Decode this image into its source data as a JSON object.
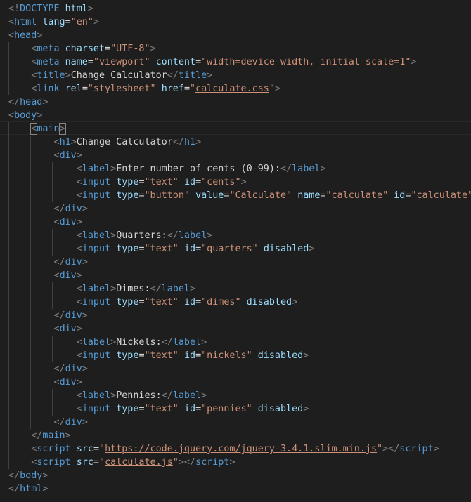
{
  "editor": {
    "language": "html",
    "theme": {
      "background": "#1e1e1e",
      "tag": "#569cd6",
      "punctuation": "#808080",
      "attribute": "#9cdcfe",
      "string": "#ce9178",
      "text": "#d4d4d4"
    },
    "lines": [
      [
        [
          "punct",
          "<!"
        ],
        [
          "tag",
          "DOCTYPE"
        ],
        [
          "txt",
          " "
        ],
        [
          "attr",
          "html"
        ],
        [
          "punct",
          ">"
        ]
      ],
      [
        [
          "punct",
          "<"
        ],
        [
          "tag",
          "html"
        ],
        [
          "txt",
          " "
        ],
        [
          "attr",
          "lang"
        ],
        [
          "txt",
          "="
        ],
        [
          "str",
          "\"en\""
        ],
        [
          "punct",
          ">"
        ]
      ],
      [
        [
          "punct",
          "<"
        ],
        [
          "tag",
          "head"
        ],
        [
          "punct",
          ">"
        ]
      ],
      [
        [
          "txt",
          "    "
        ],
        [
          "punct",
          "<"
        ],
        [
          "tag",
          "meta"
        ],
        [
          "txt",
          " "
        ],
        [
          "attr",
          "charset"
        ],
        [
          "txt",
          "="
        ],
        [
          "str",
          "\"UTF-8\""
        ],
        [
          "punct",
          ">"
        ]
      ],
      [
        [
          "txt",
          "    "
        ],
        [
          "punct",
          "<"
        ],
        [
          "tag",
          "meta"
        ],
        [
          "txt",
          " "
        ],
        [
          "attr",
          "name"
        ],
        [
          "txt",
          "="
        ],
        [
          "str",
          "\"viewport\""
        ],
        [
          "txt",
          " "
        ],
        [
          "attr",
          "content"
        ],
        [
          "txt",
          "="
        ],
        [
          "str",
          "\"width=device-width, initial-scale=1\""
        ],
        [
          "punct",
          ">"
        ]
      ],
      [
        [
          "txt",
          "    "
        ],
        [
          "punct",
          "<"
        ],
        [
          "tag",
          "title"
        ],
        [
          "punct",
          ">"
        ],
        [
          "txt",
          "Change Calculator"
        ],
        [
          "punct",
          "</"
        ],
        [
          "tag",
          "title"
        ],
        [
          "punct",
          ">"
        ]
      ],
      [
        [
          "txt",
          "    "
        ],
        [
          "punct",
          "<"
        ],
        [
          "tag",
          "link"
        ],
        [
          "txt",
          " "
        ],
        [
          "attr",
          "rel"
        ],
        [
          "txt",
          "="
        ],
        [
          "str",
          "\"stylesheet\""
        ],
        [
          "txt",
          " "
        ],
        [
          "attr",
          "href"
        ],
        [
          "txt",
          "="
        ],
        [
          "str",
          "\""
        ],
        [
          "link",
          "calculate.css"
        ],
        [
          "str",
          "\""
        ],
        [
          "punct",
          ">"
        ]
      ],
      [
        [
          "punct",
          "</"
        ],
        [
          "tag",
          "head"
        ],
        [
          "punct",
          ">"
        ]
      ],
      [
        [
          "punct",
          "<"
        ],
        [
          "tag",
          "body"
        ],
        [
          "punct",
          ">"
        ]
      ],
      [
        [
          "txt",
          "    "
        ],
        [
          "punct",
          "<"
        ],
        [
          "tag",
          "main"
        ],
        [
          "punct",
          ">"
        ]
      ],
      [
        [
          "txt",
          "        "
        ],
        [
          "punct",
          "<"
        ],
        [
          "tag",
          "h1"
        ],
        [
          "punct",
          ">"
        ],
        [
          "txt",
          "Change Calculator"
        ],
        [
          "punct",
          "</"
        ],
        [
          "tag",
          "h1"
        ],
        [
          "punct",
          ">"
        ]
      ],
      [
        [
          "txt",
          "        "
        ],
        [
          "punct",
          "<"
        ],
        [
          "tag",
          "div"
        ],
        [
          "punct",
          ">"
        ]
      ],
      [
        [
          "txt",
          "            "
        ],
        [
          "punct",
          "<"
        ],
        [
          "tag",
          "label"
        ],
        [
          "punct",
          ">"
        ],
        [
          "txt",
          "Enter number of cents (0-99):"
        ],
        [
          "punct",
          "</"
        ],
        [
          "tag",
          "label"
        ],
        [
          "punct",
          ">"
        ]
      ],
      [
        [
          "txt",
          "            "
        ],
        [
          "punct",
          "<"
        ],
        [
          "tag",
          "input"
        ],
        [
          "txt",
          " "
        ],
        [
          "attr",
          "type"
        ],
        [
          "txt",
          "="
        ],
        [
          "str",
          "\"text\""
        ],
        [
          "txt",
          " "
        ],
        [
          "attr",
          "id"
        ],
        [
          "txt",
          "="
        ],
        [
          "str",
          "\"cents\""
        ],
        [
          "punct",
          ">"
        ]
      ],
      [
        [
          "txt",
          "            "
        ],
        [
          "punct",
          "<"
        ],
        [
          "tag",
          "input"
        ],
        [
          "txt",
          " "
        ],
        [
          "attr",
          "type"
        ],
        [
          "txt",
          "="
        ],
        [
          "str",
          "\"button\""
        ],
        [
          "txt",
          " "
        ],
        [
          "attr",
          "value"
        ],
        [
          "txt",
          "="
        ],
        [
          "str",
          "\"Calculate\""
        ],
        [
          "txt",
          " "
        ],
        [
          "attr",
          "name"
        ],
        [
          "txt",
          "="
        ],
        [
          "str",
          "\"calculate\""
        ],
        [
          "txt",
          " "
        ],
        [
          "attr",
          "id"
        ],
        [
          "txt",
          "="
        ],
        [
          "str",
          "\"calculate\""
        ],
        [
          "punct",
          ">"
        ]
      ],
      [
        [
          "txt",
          "        "
        ],
        [
          "punct",
          "</"
        ],
        [
          "tag",
          "div"
        ],
        [
          "punct",
          ">"
        ]
      ],
      [
        [
          "txt",
          "        "
        ],
        [
          "punct",
          "<"
        ],
        [
          "tag",
          "div"
        ],
        [
          "punct",
          ">"
        ]
      ],
      [
        [
          "txt",
          "            "
        ],
        [
          "punct",
          "<"
        ],
        [
          "tag",
          "label"
        ],
        [
          "punct",
          ">"
        ],
        [
          "txt",
          "Quarters:"
        ],
        [
          "punct",
          "</"
        ],
        [
          "tag",
          "label"
        ],
        [
          "punct",
          ">"
        ]
      ],
      [
        [
          "txt",
          "            "
        ],
        [
          "punct",
          "<"
        ],
        [
          "tag",
          "input"
        ],
        [
          "txt",
          " "
        ],
        [
          "attr",
          "type"
        ],
        [
          "txt",
          "="
        ],
        [
          "str",
          "\"text\""
        ],
        [
          "txt",
          " "
        ],
        [
          "attr",
          "id"
        ],
        [
          "txt",
          "="
        ],
        [
          "str",
          "\"quarters\""
        ],
        [
          "txt",
          " "
        ],
        [
          "attr",
          "disabled"
        ],
        [
          "punct",
          ">"
        ]
      ],
      [
        [
          "txt",
          "        "
        ],
        [
          "punct",
          "</"
        ],
        [
          "tag",
          "div"
        ],
        [
          "punct",
          ">"
        ]
      ],
      [
        [
          "txt",
          "        "
        ],
        [
          "punct",
          "<"
        ],
        [
          "tag",
          "div"
        ],
        [
          "punct",
          ">"
        ]
      ],
      [
        [
          "txt",
          "            "
        ],
        [
          "punct",
          "<"
        ],
        [
          "tag",
          "label"
        ],
        [
          "punct",
          ">"
        ],
        [
          "txt",
          "Dimes:"
        ],
        [
          "punct",
          "</"
        ],
        [
          "tag",
          "label"
        ],
        [
          "punct",
          ">"
        ]
      ],
      [
        [
          "txt",
          "            "
        ],
        [
          "punct",
          "<"
        ],
        [
          "tag",
          "input"
        ],
        [
          "txt",
          " "
        ],
        [
          "attr",
          "type"
        ],
        [
          "txt",
          "="
        ],
        [
          "str",
          "\"text\""
        ],
        [
          "txt",
          " "
        ],
        [
          "attr",
          "id"
        ],
        [
          "txt",
          "="
        ],
        [
          "str",
          "\"dimes\""
        ],
        [
          "txt",
          " "
        ],
        [
          "attr",
          "disabled"
        ],
        [
          "punct",
          ">"
        ]
      ],
      [
        [
          "txt",
          "        "
        ],
        [
          "punct",
          "</"
        ],
        [
          "tag",
          "div"
        ],
        [
          "punct",
          ">"
        ]
      ],
      [
        [
          "txt",
          "        "
        ],
        [
          "punct",
          "<"
        ],
        [
          "tag",
          "div"
        ],
        [
          "punct",
          ">"
        ]
      ],
      [
        [
          "txt",
          "            "
        ],
        [
          "punct",
          "<"
        ],
        [
          "tag",
          "label"
        ],
        [
          "punct",
          ">"
        ],
        [
          "txt",
          "Nickels:"
        ],
        [
          "punct",
          "</"
        ],
        [
          "tag",
          "label"
        ],
        [
          "punct",
          ">"
        ]
      ],
      [
        [
          "txt",
          "            "
        ],
        [
          "punct",
          "<"
        ],
        [
          "tag",
          "input"
        ],
        [
          "txt",
          " "
        ],
        [
          "attr",
          "type"
        ],
        [
          "txt",
          "="
        ],
        [
          "str",
          "\"text\""
        ],
        [
          "txt",
          " "
        ],
        [
          "attr",
          "id"
        ],
        [
          "txt",
          "="
        ],
        [
          "str",
          "\"nickels\""
        ],
        [
          "txt",
          " "
        ],
        [
          "attr",
          "disabled"
        ],
        [
          "punct",
          ">"
        ]
      ],
      [
        [
          "txt",
          "        "
        ],
        [
          "punct",
          "</"
        ],
        [
          "tag",
          "div"
        ],
        [
          "punct",
          ">"
        ]
      ],
      [
        [
          "txt",
          "        "
        ],
        [
          "punct",
          "<"
        ],
        [
          "tag",
          "div"
        ],
        [
          "punct",
          ">"
        ]
      ],
      [
        [
          "txt",
          "            "
        ],
        [
          "punct",
          "<"
        ],
        [
          "tag",
          "label"
        ],
        [
          "punct",
          ">"
        ],
        [
          "txt",
          "Pennies:"
        ],
        [
          "punct",
          "</"
        ],
        [
          "tag",
          "label"
        ],
        [
          "punct",
          ">"
        ]
      ],
      [
        [
          "txt",
          "            "
        ],
        [
          "punct",
          "<"
        ],
        [
          "tag",
          "input"
        ],
        [
          "txt",
          " "
        ],
        [
          "attr",
          "type"
        ],
        [
          "txt",
          "="
        ],
        [
          "str",
          "\"text\""
        ],
        [
          "txt",
          " "
        ],
        [
          "attr",
          "id"
        ],
        [
          "txt",
          "="
        ],
        [
          "str",
          "\"pennies\""
        ],
        [
          "txt",
          " "
        ],
        [
          "attr",
          "disabled"
        ],
        [
          "punct",
          ">"
        ]
      ],
      [
        [
          "txt",
          "        "
        ],
        [
          "punct",
          "</"
        ],
        [
          "tag",
          "div"
        ],
        [
          "punct",
          ">"
        ]
      ],
      [
        [
          "txt",
          "    "
        ],
        [
          "punct",
          "</"
        ],
        [
          "tag",
          "main"
        ],
        [
          "punct",
          ">"
        ]
      ],
      [
        [
          "txt",
          "    "
        ],
        [
          "punct",
          "<"
        ],
        [
          "tag",
          "script"
        ],
        [
          "txt",
          " "
        ],
        [
          "attr",
          "src"
        ],
        [
          "txt",
          "="
        ],
        [
          "str",
          "\""
        ],
        [
          "link",
          "https://code.jquery.com/jquery-3.4.1.slim.min.js"
        ],
        [
          "str",
          "\""
        ],
        [
          "punct",
          "></"
        ],
        [
          "tag",
          "script"
        ],
        [
          "punct",
          ">"
        ]
      ],
      [
        [
          "txt",
          "    "
        ],
        [
          "punct",
          "<"
        ],
        [
          "tag",
          "script"
        ],
        [
          "txt",
          " "
        ],
        [
          "attr",
          "src"
        ],
        [
          "txt",
          "="
        ],
        [
          "str",
          "\""
        ],
        [
          "link",
          "calculate.js"
        ],
        [
          "str",
          "\""
        ],
        [
          "punct",
          "></"
        ],
        [
          "tag",
          "script"
        ],
        [
          "punct",
          ">"
        ]
      ],
      [
        [
          "punct",
          "</"
        ],
        [
          "tag",
          "body"
        ],
        [
          "punct",
          ">"
        ]
      ],
      [
        [
          "punct",
          "</"
        ],
        [
          "tag",
          "html"
        ],
        [
          "punct",
          ">"
        ]
      ]
    ]
  }
}
